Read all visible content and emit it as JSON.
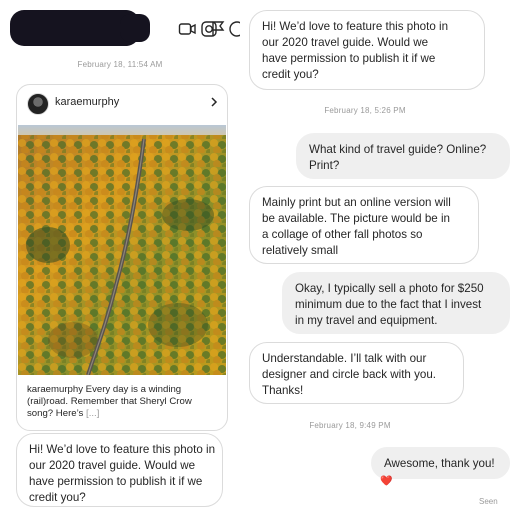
{
  "left_pane": {
    "timestamp": "February 18, 11:54 AM",
    "post": {
      "username": "karaemurphy",
      "caption_user": "karaemurphy",
      "caption_text": " Every day is a winding (rail)road. Remember that Sheryl Crow song? Here’s ",
      "caption_more": "[...]"
    },
    "message": "Hi! We’d love to feature this photo in\nour 2020 travel guide. Would we\nhave permission to publish it if we\ncredit you?"
  },
  "right_pane": {
    "msg1": "Hi! We’d love to feature this photo in\nour 2020 travel guide. Would we\nhave permission to publish it if we\ncredit you?",
    "time1": "February 18, 5:26 PM",
    "msg2": "What kind of travel guide? Online?\nPrint?",
    "msg3": "Mainly print but an online version will\nbe available. The picture would be in\na collage of other fall photos so\nrelatively small",
    "msg4": "Okay, I typically sell a photo for $250\nminimum due to the fact that I invest\nin my travel and equipment.",
    "msg5": "Understandable. I’ll talk with our\ndesigner and circle back with you.\nThanks!",
    "time2": "February 18, 9:49 PM",
    "msg6": "Awesome, thank you!",
    "reaction": "❤️",
    "seen": "Seen"
  },
  "icons": [
    "video-icon",
    "instagram-icon",
    "flag-icon",
    "info-icon",
    "chevron-right-icon"
  ]
}
